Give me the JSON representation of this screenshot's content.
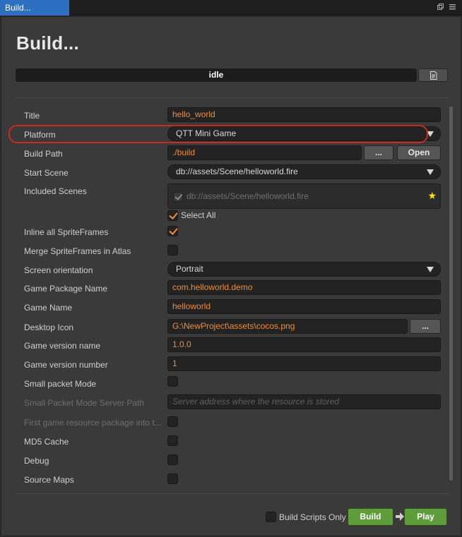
{
  "tab": {
    "title": "Build..."
  },
  "window": {
    "title": "Build..."
  },
  "status": {
    "text": "idle"
  },
  "fields": {
    "title": {
      "label": "Title",
      "value": "hello_world"
    },
    "platform": {
      "label": "Platform",
      "value": "QTT Mini Game"
    },
    "build_path": {
      "label": "Build Path",
      "value": "./build",
      "browse_label": "...",
      "open_label": "Open"
    },
    "start_scene": {
      "label": "Start Scene",
      "value": "db://assets/Scene/helloworld.fire"
    },
    "included_scenes": {
      "label": "Included Scenes",
      "items": [
        "db://assets/Scene/helloworld.fire"
      ],
      "select_all_label": "Select All"
    },
    "inline_spriteframes": {
      "label": "Inline all SpriteFrames",
      "checked": true
    },
    "merge_spriteframes": {
      "label": "Merge SpriteFrames in Atlas",
      "checked": false
    },
    "screen_orientation": {
      "label": "Screen orientation",
      "value": "Portrait"
    },
    "game_package_name": {
      "label": "Game Package Name",
      "value": "com.helloworld.demo"
    },
    "game_name": {
      "label": "Game Name",
      "value": "helloworld"
    },
    "desktop_icon": {
      "label": "Desktop Icon",
      "value": "G:\\NewProject\\assets\\cocos.png",
      "browse_label": "..."
    },
    "game_version_name": {
      "label": "Game version name",
      "value": "1.0.0"
    },
    "game_version_number": {
      "label": "Game version number",
      "value": "1"
    },
    "small_packet_mode": {
      "label": "Small packet Mode",
      "checked": false
    },
    "small_packet_server_path": {
      "label": "Small Packet Mode Server Path",
      "placeholder": "Server address where the resource is stored"
    },
    "first_game_resource": {
      "label": "First game resource package into t...",
      "checked": false
    },
    "md5_cache": {
      "label": "MD5 Cache",
      "checked": false
    },
    "debug": {
      "label": "Debug",
      "checked": false
    },
    "source_maps": {
      "label": "Source Maps",
      "checked": false
    }
  },
  "footer": {
    "build_scripts_only_label": "Build Scripts Only",
    "build_label": "Build",
    "play_label": "Play"
  },
  "colors": {
    "accent": "#f08b3a",
    "tab": "#2d6fc0",
    "action_button": "#5f9d3c",
    "highlight_ring": "#cc2a1f"
  }
}
